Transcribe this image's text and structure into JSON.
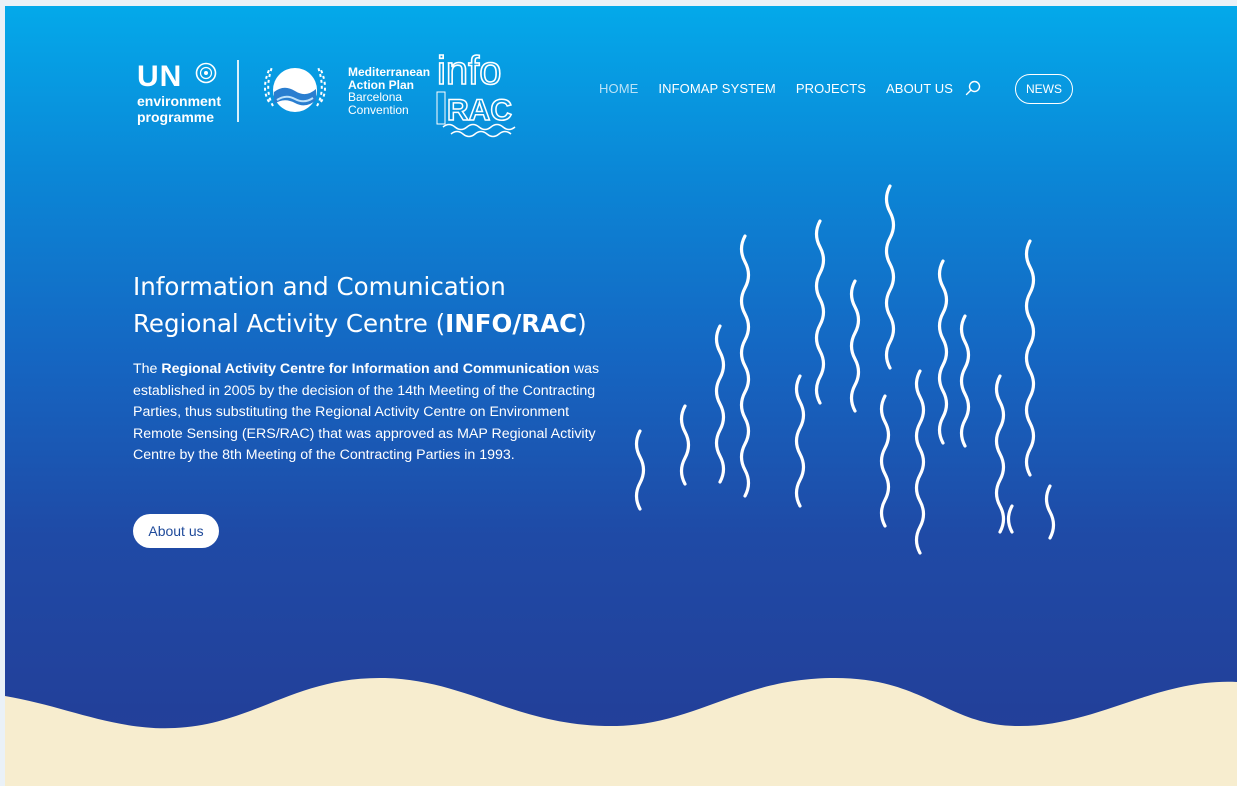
{
  "header": {
    "un_logo": {
      "title": "UN",
      "line1": "environment",
      "line2": "programme"
    },
    "map_logo": {
      "line1": "Mediterranean",
      "line2": "Action Plan",
      "line3": "Barcelona",
      "line4": "Convention"
    },
    "info_logo": {
      "top": "info",
      "bottom": "RAC"
    }
  },
  "nav": {
    "items": [
      {
        "label": "HOME",
        "active": true
      },
      {
        "label": "INFOMAP SYSTEM"
      },
      {
        "label": "PROJECTS"
      },
      {
        "label": "ABOUT US"
      }
    ],
    "search_icon": "search-icon",
    "news_label": "NEWS"
  },
  "hero": {
    "title_line1": "Information and Comunication",
    "title_line2_prefix": "Regional Activity Centre (",
    "title_line2_bold": "INFO/RAC",
    "title_line2_suffix": ")",
    "desc_prefix": "The ",
    "desc_bold": "Regional Activity Centre for Information and Communication",
    "desc_rest": " was established in 2005 by the decision of the 14th Meeting of the Contracting Parties, thus substituting the Regional Activity Centre on Environment Remote Sensing (ERS/RAC) that was approved as MAP Regional Activity Centre by the 8th Meeting of the Contracting Parties in 1993.",
    "button_label": "About us"
  },
  "colors": {
    "gradient_top": "#04a9ea",
    "gradient_bottom": "#243c95",
    "sand": "#f7edcf",
    "white": "#ffffff"
  }
}
